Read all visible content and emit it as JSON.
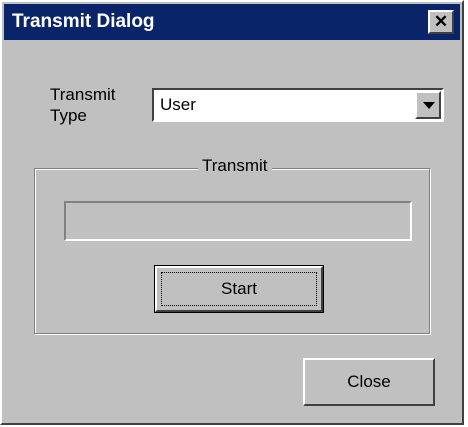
{
  "window": {
    "title": "Transmit Dialog",
    "close_glyph": "✕"
  },
  "transmit_type": {
    "label": "Transmit\nType",
    "selected": "User"
  },
  "group": {
    "legend": "Transmit"
  },
  "progress": {
    "value": 0
  },
  "buttons": {
    "start": "Start",
    "close": "Close"
  },
  "colors": {
    "titlebar": "#0a246a",
    "face": "#c0c0c0"
  }
}
